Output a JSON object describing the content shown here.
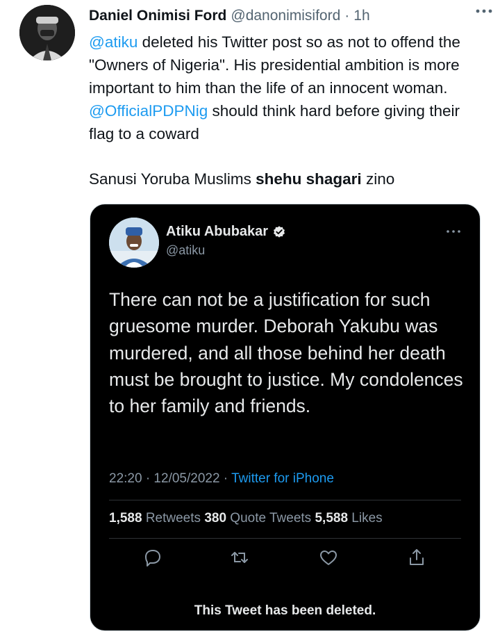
{
  "tweet": {
    "author_name": "Daniel Onimisi Ford",
    "author_handle": "@danonimisiford",
    "separator": "·",
    "time": "1h",
    "icons": {
      "avatar": "avatar-photo",
      "more": "more-icon"
    },
    "body": {
      "mention1": "@atiku",
      "text1": " deleted his Twitter post so as not to offend the \"Owners of Nigeria\". His presidential ambition is more important to him than the life of an innocent woman. ",
      "mention2": "@OfficialPDPNig",
      "text2": " should think hard before giving their flag to a coward"
    },
    "line2": {
      "pre": "Sanusi Yoruba Muslims ",
      "bold": "shehu shagari",
      "post": " zino"
    }
  },
  "embedded": {
    "name": "Atiku Abubakar",
    "handle": "@atiku",
    "verified_icon": "verified-badge-icon",
    "text": "There can not be a justification for such gruesome murder. Deborah Yakubu was murdered, and all those behind her death must be brought to justice. My condolences to her family and friends.",
    "timestamp": "22:20 · 12/05/2022 · ",
    "source": "Twitter for iPhone",
    "retweets_count": "1,588",
    "retweets_label": " Retweets ",
    "quotes_count": "380",
    "quotes_label": " Quote Tweets ",
    "likes_count": "5,588",
    "likes_label": " Likes",
    "actions": [
      "reply-icon",
      "retweet-icon",
      "like-icon",
      "share-icon"
    ],
    "deleted_notice": "This Tweet has been deleted.",
    "colors": {
      "background": "#000000",
      "text": "#e7e9ea",
      "muted": "#8b98a5",
      "link": "#1d9bf0"
    }
  }
}
